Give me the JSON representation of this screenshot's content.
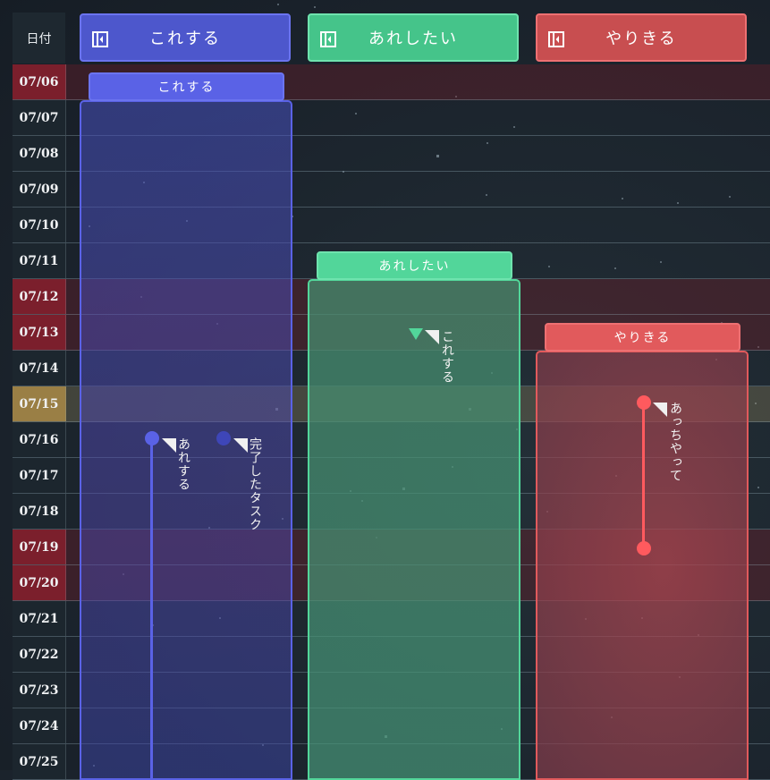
{
  "date_header": "日付",
  "dates": [
    {
      "label": "07/06",
      "kind": "weekend"
    },
    {
      "label": "07/07",
      "kind": "normal"
    },
    {
      "label": "07/08",
      "kind": "normal"
    },
    {
      "label": "07/09",
      "kind": "normal"
    },
    {
      "label": "07/10",
      "kind": "normal"
    },
    {
      "label": "07/11",
      "kind": "normal"
    },
    {
      "label": "07/12",
      "kind": "weekend"
    },
    {
      "label": "07/13",
      "kind": "weekend"
    },
    {
      "label": "07/14",
      "kind": "normal"
    },
    {
      "label": "07/15",
      "kind": "today"
    },
    {
      "label": "07/16",
      "kind": "normal"
    },
    {
      "label": "07/17",
      "kind": "normal"
    },
    {
      "label": "07/18",
      "kind": "normal"
    },
    {
      "label": "07/19",
      "kind": "weekend"
    },
    {
      "label": "07/20",
      "kind": "weekend"
    },
    {
      "label": "07/21",
      "kind": "normal"
    },
    {
      "label": "07/22",
      "kind": "normal"
    },
    {
      "label": "07/23",
      "kind": "normal"
    },
    {
      "label": "07/24",
      "kind": "normal"
    },
    {
      "label": "07/25",
      "kind": "normal"
    }
  ],
  "columns": [
    {
      "title": "これする",
      "tag": "これする",
      "color": "#5a62e6"
    },
    {
      "title": "あれしたい",
      "tag": "あれしたい",
      "color": "#52d69a"
    },
    {
      "title": "やりきる",
      "tag": "やりきる",
      "color": "#e15a5c"
    }
  ],
  "tasks": {
    "col1_task1": "あれする",
    "col1_task2": "完了したタスク",
    "col2_task1": "これする",
    "col3_task1": "あっちやって"
  }
}
